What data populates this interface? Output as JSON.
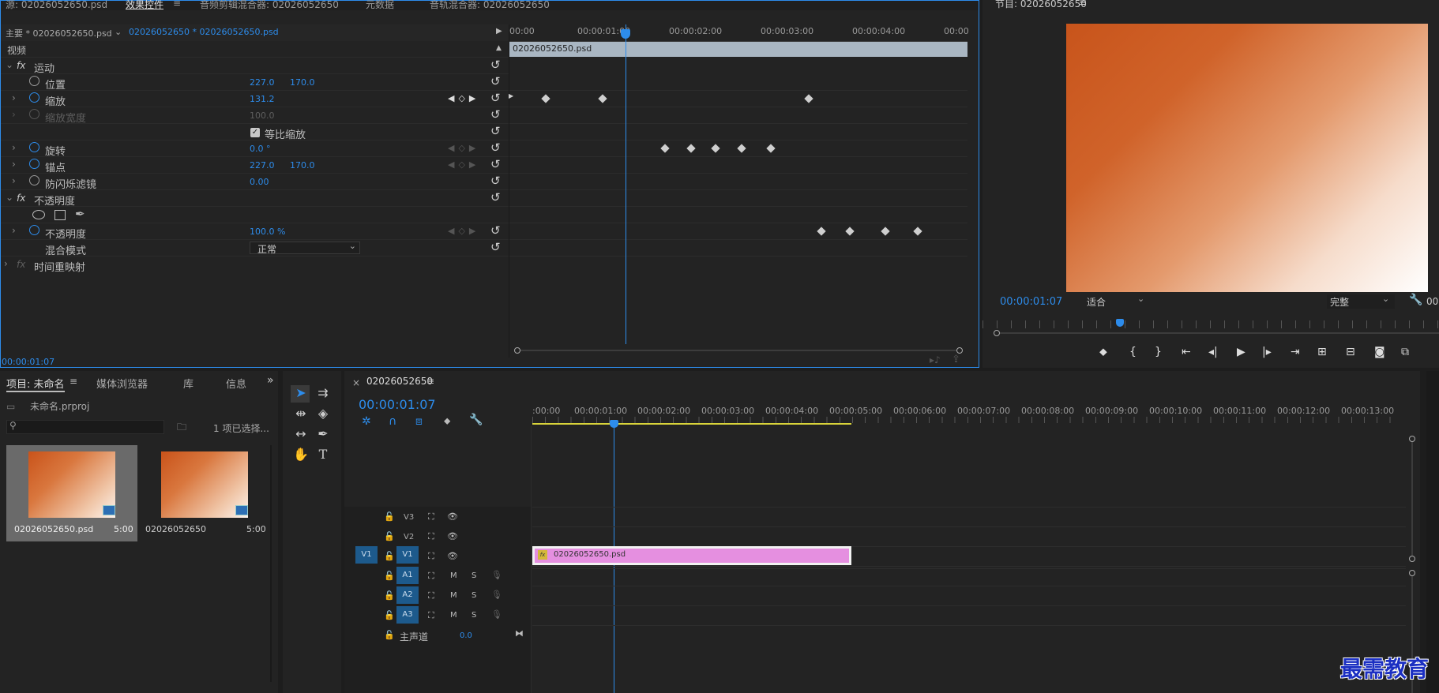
{
  "top_tabs": {
    "source": "源: 02026052650.psd",
    "effect_controls": "效果控件",
    "audio_mixer": "音频剪辑混合器: 02026052650",
    "metadata": "元数据",
    "track_mixer": "音轨混合器: 02026052650",
    "program": "节目: 02026052650"
  },
  "effect_controls": {
    "clip_tab_master": "主要 * 02026052650.psd",
    "clip_tab_seq": "02026052650 * 02026052650.psd",
    "video_header": "视频",
    "motion": "运动",
    "position": {
      "label": "位置",
      "x": "227.0",
      "y": "170.0"
    },
    "scale": {
      "label": "缩放",
      "value": "131.2"
    },
    "scale_width": {
      "label": "缩放宽度",
      "value": "100.0"
    },
    "uniform_scale": "等比缩放",
    "rotation": {
      "label": "旋转",
      "value": "0.0 °"
    },
    "anchor": {
      "label": "锚点",
      "x": "227.0",
      "y": "170.0"
    },
    "flicker": {
      "label": "防闪烁滤镜",
      "value": "0.00"
    },
    "opacity_group": "不透明度",
    "opacity": {
      "label": "不透明度",
      "value": "100.0 %"
    },
    "blend_mode": {
      "label": "混合模式",
      "value": "正常"
    },
    "time_remap": "时间重映射",
    "fx_label": "fx",
    "timecode": "00:00:01:07",
    "ruler": [
      "00:00",
      "00:00:01:00",
      "00:00:02:00",
      "00:00:03:00",
      "00:00:04:00",
      "00:00"
    ],
    "clip_bar_name": "02026052650.psd"
  },
  "program": {
    "timecode": "00:00:01:07",
    "fit": "适合",
    "quality": "完整",
    "tail": "00"
  },
  "project": {
    "tabs": [
      "项目: 未命名",
      "媒体浏览器",
      "库",
      "信息"
    ],
    "file": "未命名.prproj",
    "selection": "1 项已选择...",
    "items": [
      {
        "name": "02026052650.psd",
        "duration": "5:00"
      },
      {
        "name": "02026052650",
        "duration": "5:00"
      }
    ]
  },
  "timeline": {
    "title": "02026052650",
    "timecode": "00:00:01:07",
    "ruler": [
      ":00:00",
      "00:00:01:00",
      "00:00:02:00",
      "00:00:03:00",
      "00:00:04:00",
      "00:00:05:00",
      "00:00:06:00",
      "00:00:07:00",
      "00:00:08:00",
      "00:00:09:00",
      "00:00:10:00",
      "00:00:11:00",
      "00:00:12:00",
      "00:00:13:00"
    ],
    "tracks": {
      "v3": "V3",
      "v2": "V2",
      "v1": "V1",
      "a1": "A1",
      "a2": "A2",
      "a3": "A3",
      "m": "M",
      "s": "S"
    },
    "master": {
      "label": "主声道",
      "value": "0.0"
    },
    "clip_name": "02026052650.psd",
    "clip_color": "#e58fe0"
  },
  "watermark": "最需教育"
}
